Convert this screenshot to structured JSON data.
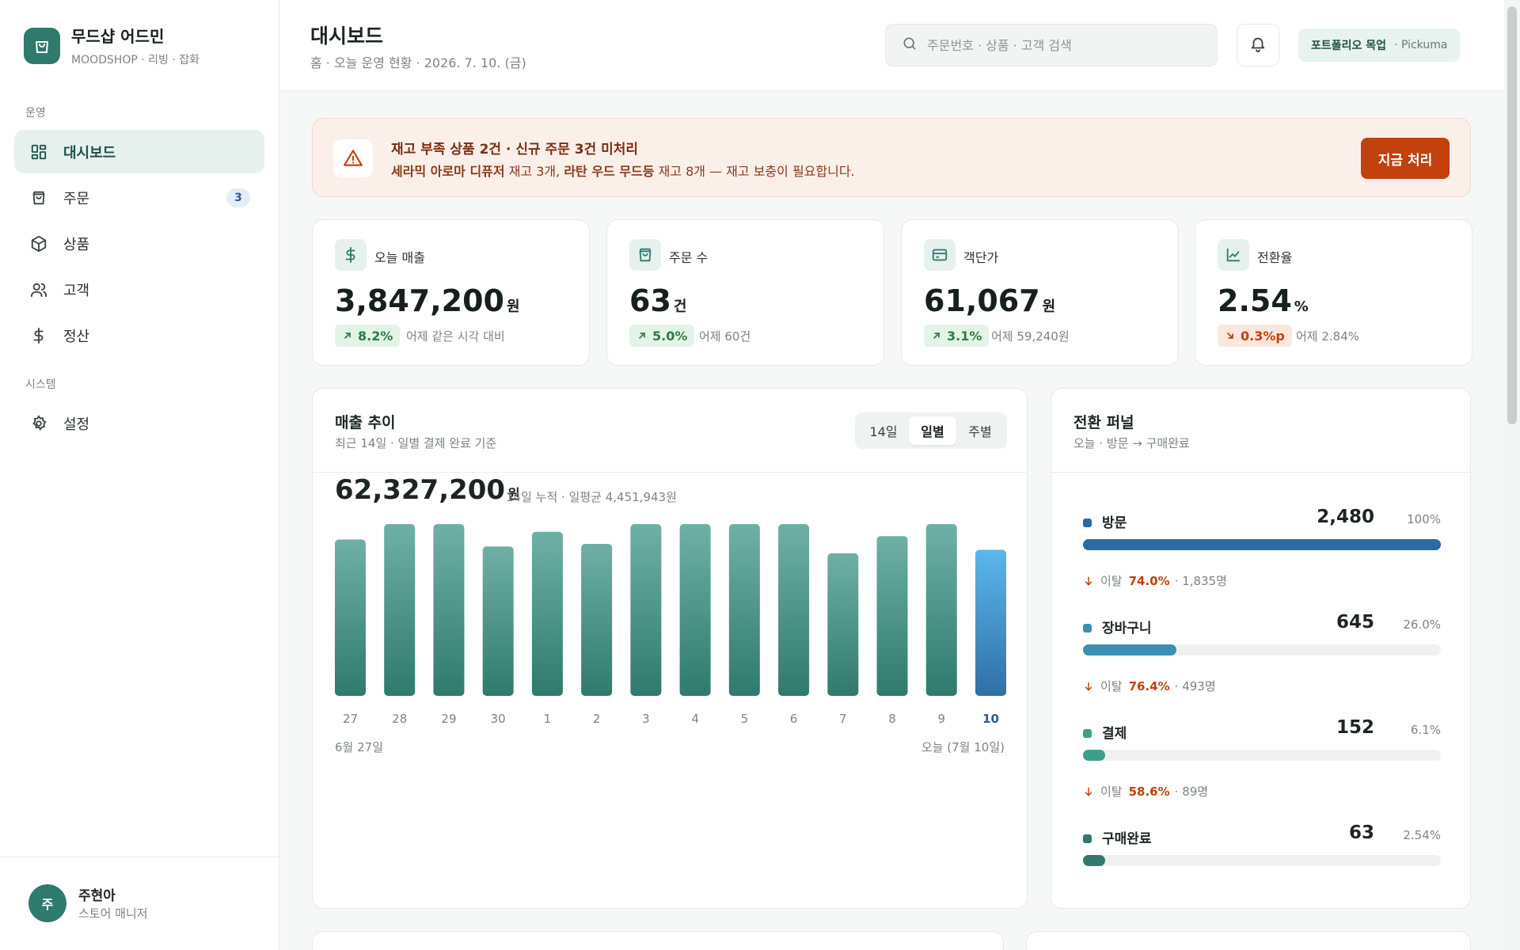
{
  "sidebar": {
    "brand_name": "무드샵 어드민",
    "brand_sub": "MOODSHOP · 리빙 · 잡화",
    "section_ops": "운영",
    "section_system": "시스템",
    "items": [
      {
        "label": "대시보드",
        "icon": "dashboard-icon"
      },
      {
        "label": "주문",
        "icon": "bag-icon",
        "badge": "3"
      },
      {
        "label": "상품",
        "icon": "box-icon"
      },
      {
        "label": "고객",
        "icon": "users-icon"
      },
      {
        "label": "정산",
        "icon": "dollar-icon"
      },
      {
        "label": "설정",
        "icon": "gear-icon"
      }
    ],
    "user": {
      "initial": "주",
      "name": "주현아",
      "role": "스토어 매니저"
    }
  },
  "header": {
    "title": "대시보드",
    "breadcrumb": "홈 · 오늘 운영 현황 · 2026. 7. 10. (금)",
    "search_placeholder": "주문번호 · 상품 · 고객 검색",
    "tag_strong": "포트폴리오 목업",
    "tag_light": "· Pickuma"
  },
  "alert": {
    "title": "재고 부족 상품 2건 · 신규 주문 3건 미처리",
    "item1": "세라믹 아로마 디퓨저",
    "text1": " 재고 3개, ",
    "item2": "라탄 우드 무드등",
    "text2": " 재고 8개 — 재고 보충이 필요합니다.",
    "button": "지금 처리"
  },
  "kpis": [
    {
      "label": "오늘 매출",
      "value": "3,847,200",
      "unit": "원",
      "delta": "8.2%",
      "dir": "up",
      "compare": "어제 같은 시각 대비",
      "icon": "dollar-icon"
    },
    {
      "label": "주문 수",
      "value": "63",
      "unit": "건",
      "delta": "5.0%",
      "dir": "up",
      "compare": "어제 60건",
      "icon": "bag-icon"
    },
    {
      "label": "객단가",
      "value": "61,067",
      "unit": "원",
      "delta": "3.1%",
      "dir": "up",
      "compare": "어제 59,240원",
      "icon": "card-icon"
    },
    {
      "label": "전환율",
      "value": "2.54",
      "unit": "%",
      "delta": "0.3%p",
      "dir": "down",
      "compare": "어제 2.84%",
      "icon": "trend-icon"
    }
  ],
  "sales": {
    "title": "매출 추이",
    "subtitle": "최근 14일 · 일별 결제 완료 기준",
    "tabs": [
      "14일",
      "일별",
      "주별"
    ],
    "active_tab": 1,
    "total": "62,327,200",
    "total_unit": "원",
    "total_note": "14일 누적 · 일평균 4,451,943원",
    "range_start": "6월 27일",
    "range_end": "오늘 (7월 10일)"
  },
  "chart_data": {
    "type": "bar",
    "categories": [
      "27",
      "28",
      "29",
      "30",
      "1",
      "2",
      "3",
      "4",
      "5",
      "6",
      "7",
      "8",
      "9",
      "10"
    ],
    "values": [
      0.91,
      1.0,
      1.0,
      0.87,
      0.955,
      0.885,
      1.0,
      1.0,
      1.0,
      1.0,
      0.83,
      0.93,
      1.0,
      0.85
    ],
    "highlight_index": 13,
    "ylabel": "",
    "xlabel": "",
    "colors": {
      "bar_top": "#6fb0a6",
      "bar_bottom": "#2f7a6d",
      "highlight_top": "#5ab8ec",
      "highlight_bottom": "#2f6fa8"
    }
  },
  "funnel": {
    "title": "전환 퍼널",
    "subtitle": "오늘 · 방문 → 구매완료",
    "drop_label": "이탈",
    "steps": [
      {
        "label": "방문",
        "value": "2,480",
        "pct": "100%",
        "ratio": 1.0,
        "color": "#2a6aa8"
      },
      {
        "label": "장바구니",
        "value": "645",
        "pct": "26.0%",
        "ratio": 0.26,
        "color": "#3a8fb2"
      },
      {
        "label": "결제",
        "value": "152",
        "pct": "6.1%",
        "ratio": 0.061,
        "color": "#3d9e8c"
      },
      {
        "label": "구매완료",
        "value": "63",
        "pct": "2.54%",
        "ratio": 0.0254,
        "color": "#2f7a6d"
      }
    ],
    "drops": [
      {
        "rate": "74.0%",
        "count": "· 1,835명"
      },
      {
        "rate": "76.4%",
        "count": "· 493명"
      },
      {
        "rate": "58.6%",
        "count": "· 89명"
      }
    ]
  }
}
